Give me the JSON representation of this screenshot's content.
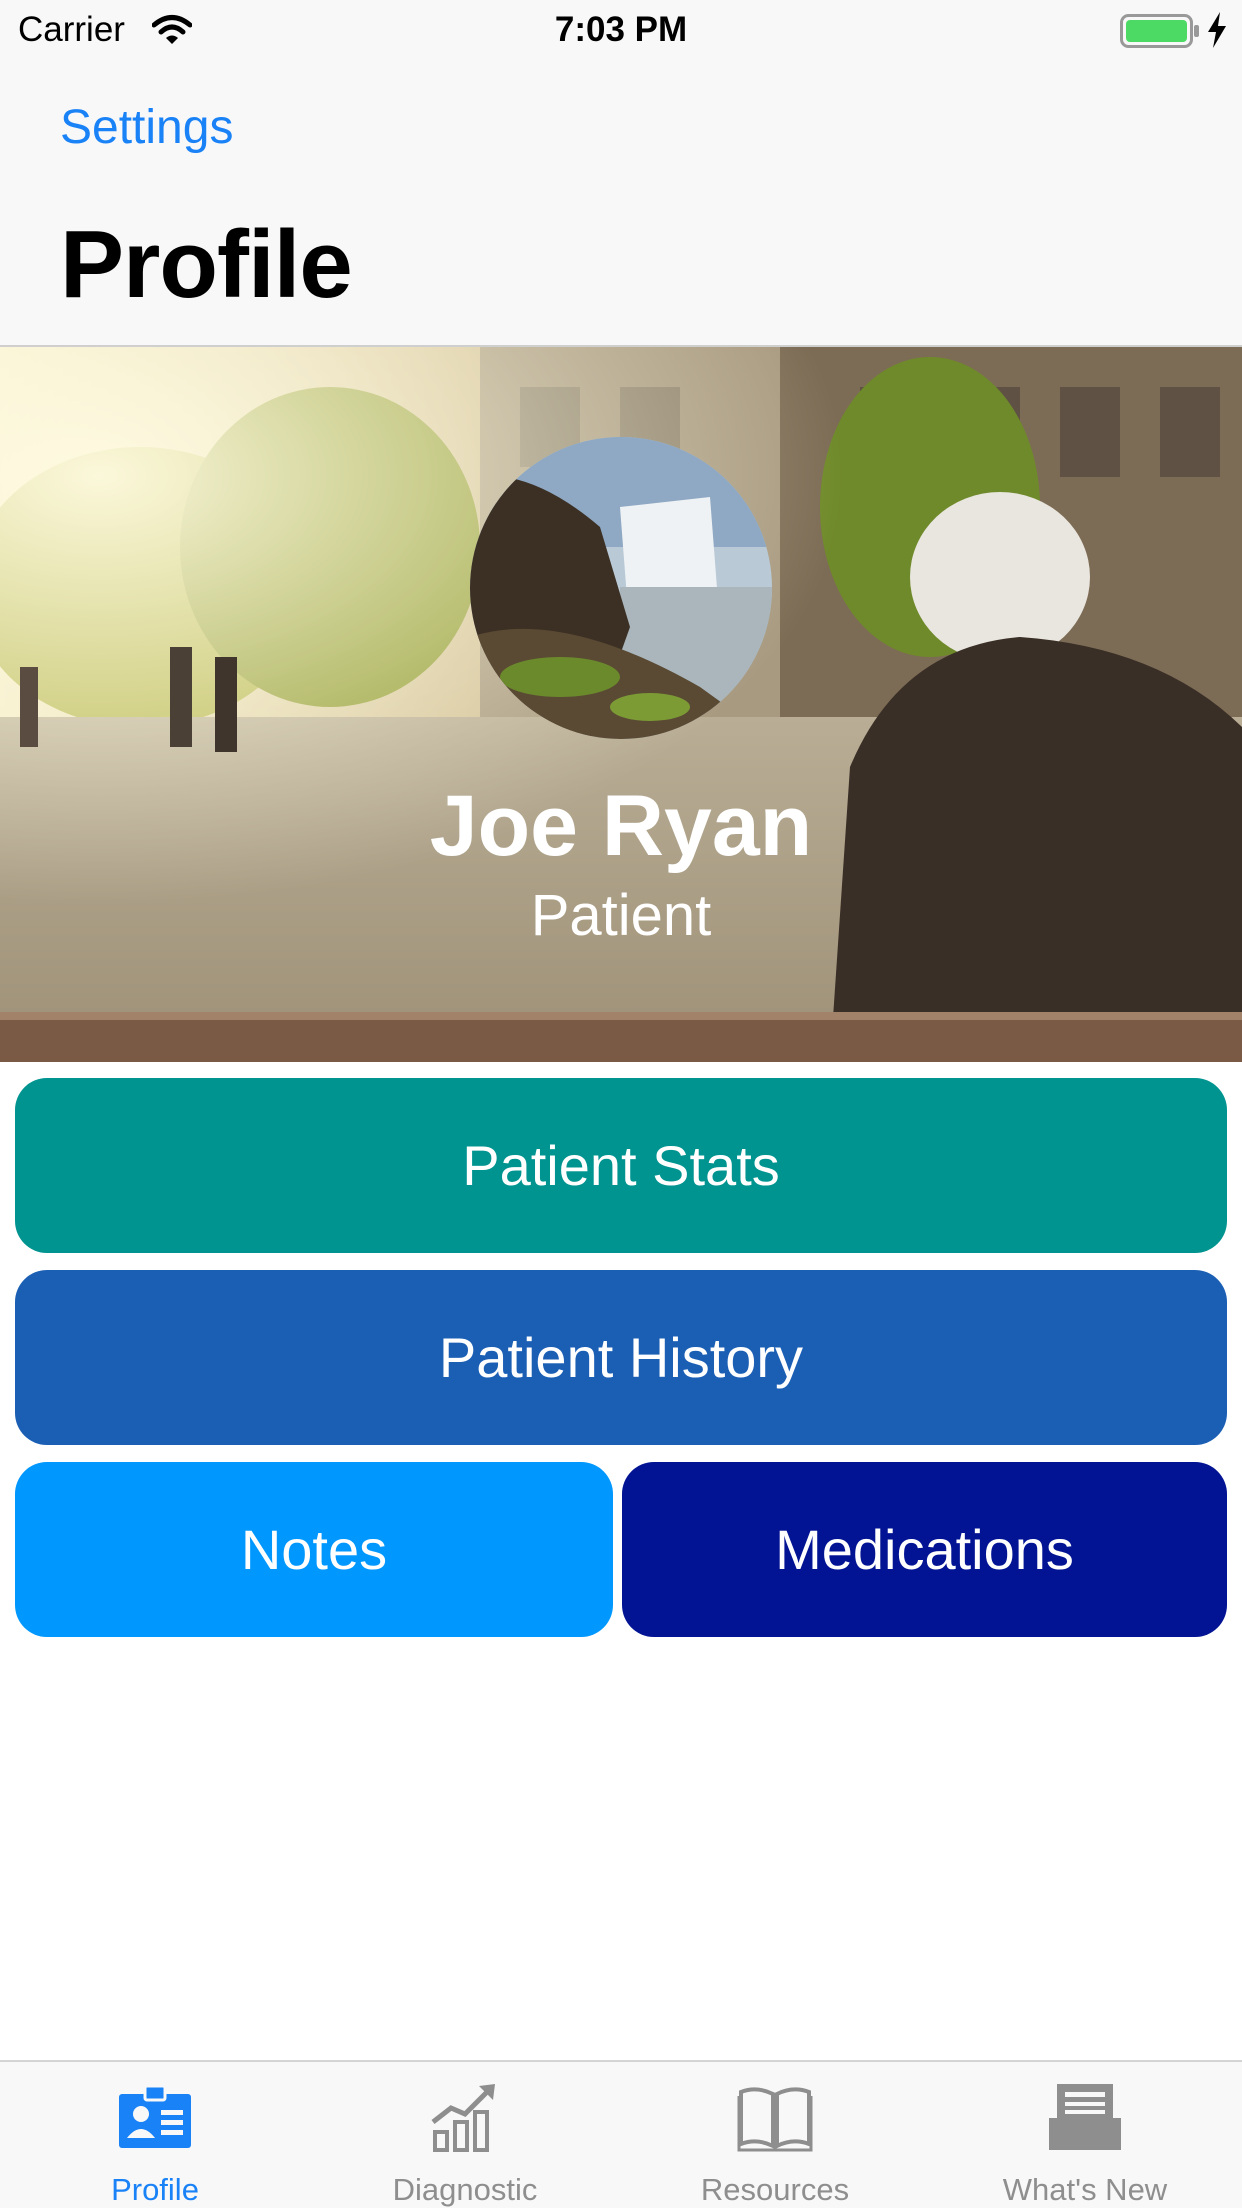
{
  "status_bar": {
    "carrier": "Carrier",
    "time": "7:03 PM"
  },
  "nav": {
    "back_label": "Settings",
    "title": "Profile"
  },
  "profile": {
    "name": "Joe Ryan",
    "role": "Patient"
  },
  "actions": [
    {
      "label": "Patient Stats",
      "color": "#009490"
    },
    {
      "label": "Patient History",
      "color": "#1b5fb5"
    },
    {
      "label": "Notes",
      "color": "#0097ff"
    },
    {
      "label": "Medications",
      "color": "#021493"
    }
  ],
  "tabs": [
    {
      "label": "Profile",
      "icon": "profile-card-icon",
      "active": true
    },
    {
      "label": "Diagnostic",
      "icon": "chart-growth-icon",
      "active": false
    },
    {
      "label": "Resources",
      "icon": "book-icon",
      "active": false
    },
    {
      "label": "What's New",
      "icon": "news-tray-icon",
      "active": false
    }
  ],
  "colors": {
    "accent": "#1a82f7",
    "tab_inactive": "#8e8e8e",
    "battery": "#4cd964"
  }
}
